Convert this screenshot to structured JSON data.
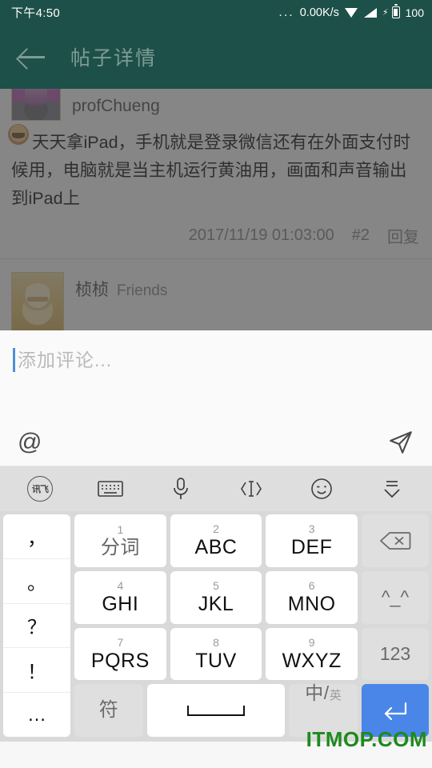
{
  "status_bar": {
    "time": "下午4:50",
    "overflow": "...",
    "network_speed": "0.00K/s",
    "wifi_icon": "wifi-icon",
    "signal_icon": "signal-icon",
    "charging_icon": "charging-bolt-icon",
    "battery_icon": "battery-icon",
    "battery_level": "100"
  },
  "app_bar": {
    "back_icon": "back-arrow-icon",
    "title": "帖子详情"
  },
  "thread": {
    "posts": [
      {
        "avatar": "user-avatar",
        "username": "profChueng",
        "badge": "",
        "body": "天天拿iPad，手机就是登录微信还有在外面支付时候用，电脑就是当主机运行黄油用，画面和声音输出到iPad上",
        "timestamp": "2017/11/19 01:03:00",
        "floor": "#2",
        "reply_label": "回复"
      },
      {
        "avatar": "user-avatar",
        "username": "桢桢",
        "badge": "Friends",
        "body": "",
        "timestamp": "",
        "floor": "",
        "reply_label": ""
      }
    ]
  },
  "editor": {
    "placeholder": "添加评论...",
    "value": "",
    "mention_icon": "at-icon",
    "send_icon": "send-paper-plane-icon"
  },
  "keyboard": {
    "toolbar": [
      {
        "name": "ime-logo-icon",
        "label": "讯飞"
      },
      {
        "name": "keyboard-icon",
        "label": ""
      },
      {
        "name": "microphone-icon",
        "label": ""
      },
      {
        "name": "text-cursor-icon",
        "label": ""
      },
      {
        "name": "emoji-icon",
        "label": ""
      },
      {
        "name": "collapse-keyboard-icon",
        "label": ""
      }
    ],
    "punctuation_keys": [
      "，",
      "。",
      "？",
      "！",
      "…"
    ],
    "rows": [
      [
        {
          "num": "1",
          "main": "分词",
          "cn": true
        },
        {
          "num": "2",
          "main": "ABC",
          "cn": false
        },
        {
          "num": "3",
          "main": "DEF",
          "cn": false
        }
      ],
      [
        {
          "num": "4",
          "main": "GHI",
          "cn": false
        },
        {
          "num": "5",
          "main": "JKL",
          "cn": false
        },
        {
          "num": "6",
          "main": "MNO",
          "cn": false
        }
      ],
      [
        {
          "num": "7",
          "main": "PQRS",
          "cn": false
        },
        {
          "num": "8",
          "main": "TUV",
          "cn": false
        },
        {
          "num": "9",
          "main": "WXYZ",
          "cn": false
        }
      ]
    ],
    "bottom_row": {
      "symbol_key": "符",
      "space_key": "space-bar",
      "lang_main": "中/",
      "lang_sub": "英"
    },
    "function_keys": [
      {
        "name": "backspace-icon",
        "label": ""
      },
      {
        "name": "kaomoji-key",
        "label": "^_^"
      },
      {
        "name": "numeric-key",
        "label": "123"
      },
      {
        "name": "enter-icon",
        "label": ""
      }
    ]
  },
  "watermark": {
    "text": "ITMOP.COM",
    "color": "#1d8a1d"
  }
}
